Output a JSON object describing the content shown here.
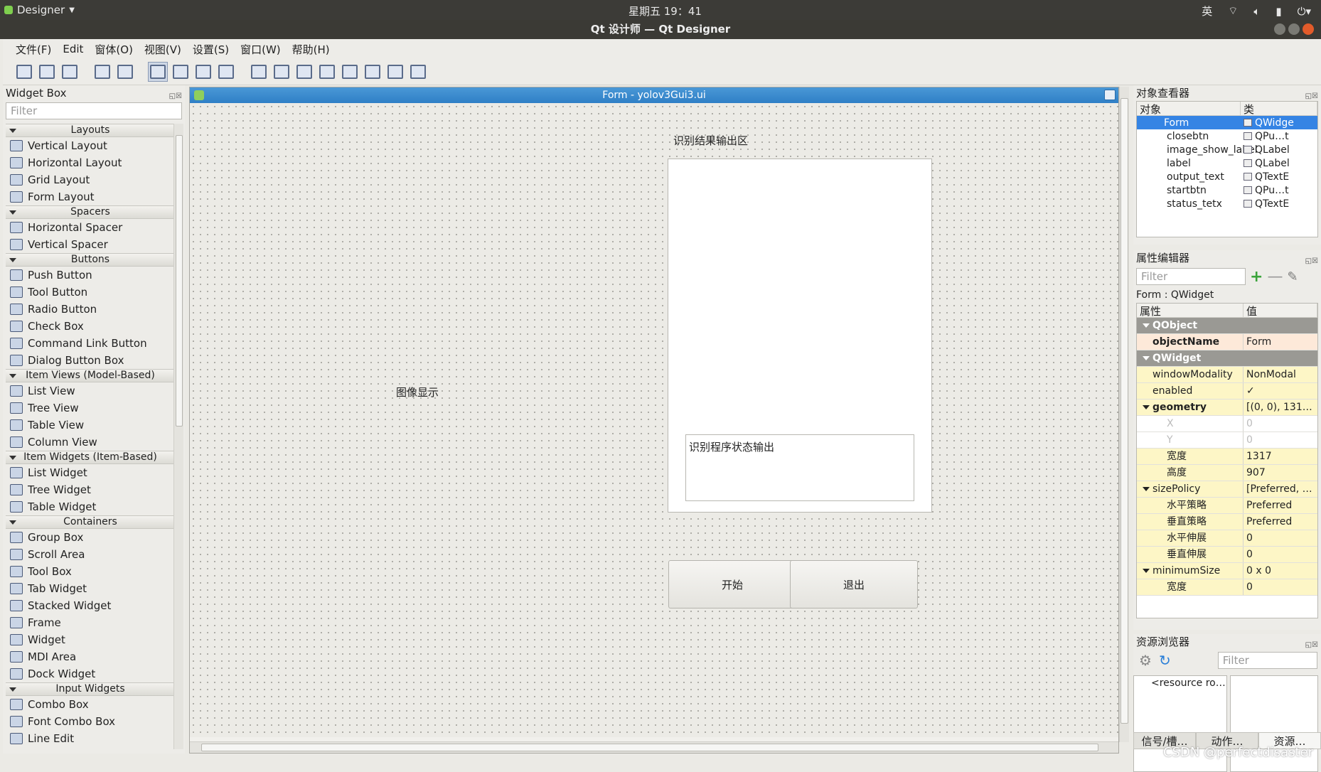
{
  "system": {
    "app_menu": "Designer",
    "clock": "星期五 19：41",
    "input_method": "英"
  },
  "window": {
    "title": "Qt 设计师 — Qt Designer"
  },
  "menu": [
    "文件(F)",
    "Edit",
    "窗体(O)",
    "视图(V)",
    "设置(S)",
    "窗口(W)",
    "帮助(H)"
  ],
  "widget_box": {
    "title": "Widget Box",
    "filter_placeholder": "Filter",
    "categories": [
      {
        "name": "Layouts",
        "items": [
          "Vertical Layout",
          "Horizontal Layout",
          "Grid Layout",
          "Form Layout"
        ]
      },
      {
        "name": "Spacers",
        "items": [
          "Horizontal Spacer",
          "Vertical Spacer"
        ]
      },
      {
        "name": "Buttons",
        "items": [
          "Push Button",
          "Tool Button",
          "Radio Button",
          "Check Box",
          "Command Link Button",
          "Dialog Button Box"
        ]
      },
      {
        "name": "Item Views (Model-Based)",
        "items": [
          "List View",
          "Tree View",
          "Table View",
          "Column View"
        ]
      },
      {
        "name": "Item Widgets (Item-Based)",
        "items": [
          "List Widget",
          "Tree Widget",
          "Table Widget"
        ]
      },
      {
        "name": "Containers",
        "items": [
          "Group Box",
          "Scroll Area",
          "Tool Box",
          "Tab Widget",
          "Stacked Widget",
          "Frame",
          "Widget",
          "MDI Area",
          "Dock Widget"
        ]
      },
      {
        "name": "Input Widgets",
        "items": [
          "Combo Box",
          "Font Combo Box",
          "Line Edit"
        ]
      }
    ]
  },
  "form": {
    "title": "Form - yolov3Gui3.ui",
    "result_area_label": "识别结果输出区",
    "image_label": "图像显示",
    "status_label": "识别程序状态输出",
    "start_button": "开始",
    "exit_button": "退出"
  },
  "object_inspector": {
    "title": "对象查看器",
    "col_object": "对象",
    "col_class": "类",
    "rows": [
      {
        "name": "Form",
        "cls": "QWidge"
      },
      {
        "name": "closebtn",
        "cls": "QPu…t"
      },
      {
        "name": "image_show_label",
        "cls": "QLabel"
      },
      {
        "name": "label",
        "cls": "QLabel"
      },
      {
        "name": "output_text",
        "cls": "QTextE"
      },
      {
        "name": "startbtn",
        "cls": "QPu…t"
      },
      {
        "name": "status_tetx",
        "cls": "QTextE"
      }
    ]
  },
  "property_editor": {
    "title": "属性编辑器",
    "filter_placeholder": "Filter",
    "context": "Form : QWidget",
    "col_prop": "属性",
    "col_value": "值",
    "rows": [
      {
        "k": "QObject",
        "v": "",
        "type": "grp"
      },
      {
        "k": "objectName",
        "v": "Form",
        "type": "pk-bold"
      },
      {
        "k": "QWidget",
        "v": "",
        "type": "grp"
      },
      {
        "k": "windowModality",
        "v": "NonModal",
        "type": "y"
      },
      {
        "k": "enabled",
        "v": "✓",
        "type": "y"
      },
      {
        "k": "geometry",
        "v": "[(0, 0), 131…",
        "type": "y-bold-tri"
      },
      {
        "k": "X",
        "v": "0",
        "type": "dis"
      },
      {
        "k": "Y",
        "v": "0",
        "type": "dis"
      },
      {
        "k": "宽度",
        "v": "1317",
        "type": "y-sub"
      },
      {
        "k": "高度",
        "v": "907",
        "type": "y-sub"
      },
      {
        "k": "sizePolicy",
        "v": "[Preferred, …",
        "type": "y-tri"
      },
      {
        "k": "水平策略",
        "v": "Preferred",
        "type": "y-sub"
      },
      {
        "k": "垂直策略",
        "v": "Preferred",
        "type": "y-sub"
      },
      {
        "k": "水平伸展",
        "v": "0",
        "type": "y-sub"
      },
      {
        "k": "垂直伸展",
        "v": "0",
        "type": "y-sub"
      },
      {
        "k": "minimumSize",
        "v": "0 x 0",
        "type": "y-tri"
      },
      {
        "k": "宽度",
        "v": "0",
        "type": "y-sub"
      }
    ]
  },
  "resource_browser": {
    "title": "资源浏览器",
    "filter_placeholder": "Filter",
    "root": "<resource ro…",
    "tabs": [
      "信号/槽…",
      "动作…",
      "资源…"
    ]
  },
  "watermark": "CSDN @perfectdisaster"
}
